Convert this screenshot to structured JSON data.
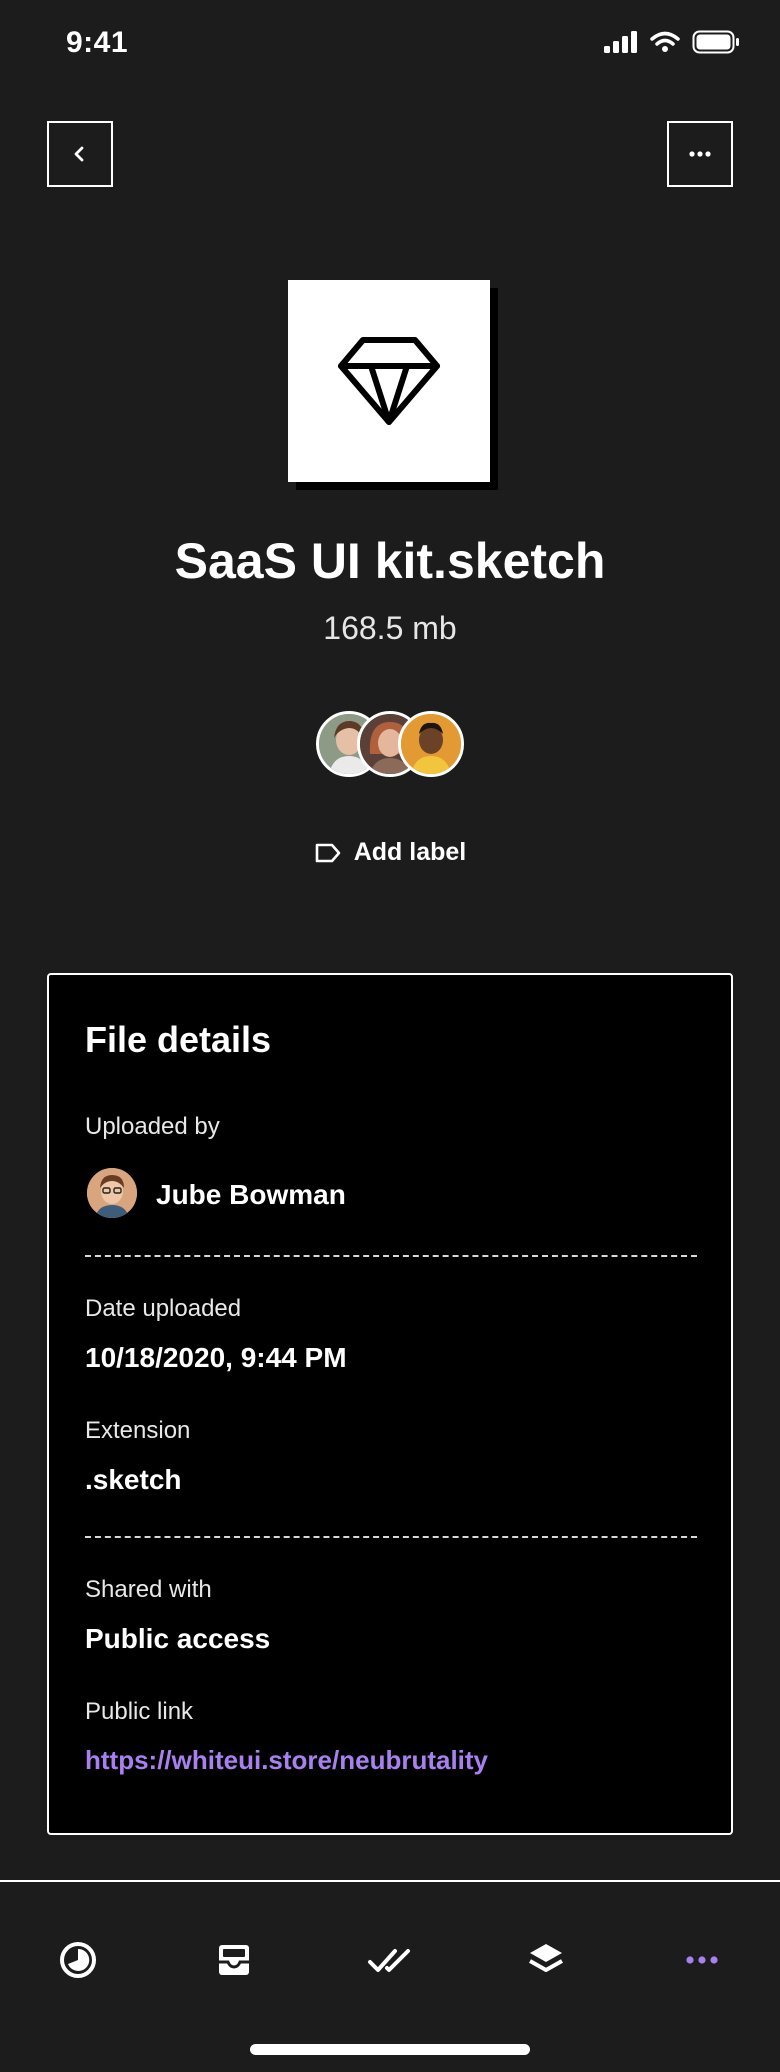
{
  "status_bar": {
    "time": "9:41"
  },
  "file": {
    "name": "SaaS UI kit.sketch",
    "size": "168.5 mb",
    "icon": "diamond-icon"
  },
  "shared_avatars": [
    "avatar-woman-1",
    "avatar-woman-2",
    "avatar-man-1"
  ],
  "add_label": {
    "label": "Add label",
    "icon": "tag-icon"
  },
  "details": {
    "title": "File details",
    "uploaded_by_label": "Uploaded by",
    "uploader_name": "Jube Bowman",
    "date_uploaded_label": "Date uploaded",
    "date_uploaded_value": "10/18/2020, 9:44 PM",
    "extension_label": "Extension",
    "extension_value": ".sketch",
    "shared_with_label": "Shared with",
    "shared_with_value": "Public access",
    "public_link_label": "Public link",
    "public_link_value": "https://whiteui.store/neubrutality"
  },
  "tabbar": {
    "items": [
      "activity-icon",
      "inbox-icon",
      "tasks-icon",
      "layers-icon",
      "more-icon"
    ],
    "active": "more-icon"
  },
  "colors": {
    "background": "#1c1c1c",
    "card": "#000000",
    "accent": "#a980f0",
    "text": "#ffffff"
  }
}
